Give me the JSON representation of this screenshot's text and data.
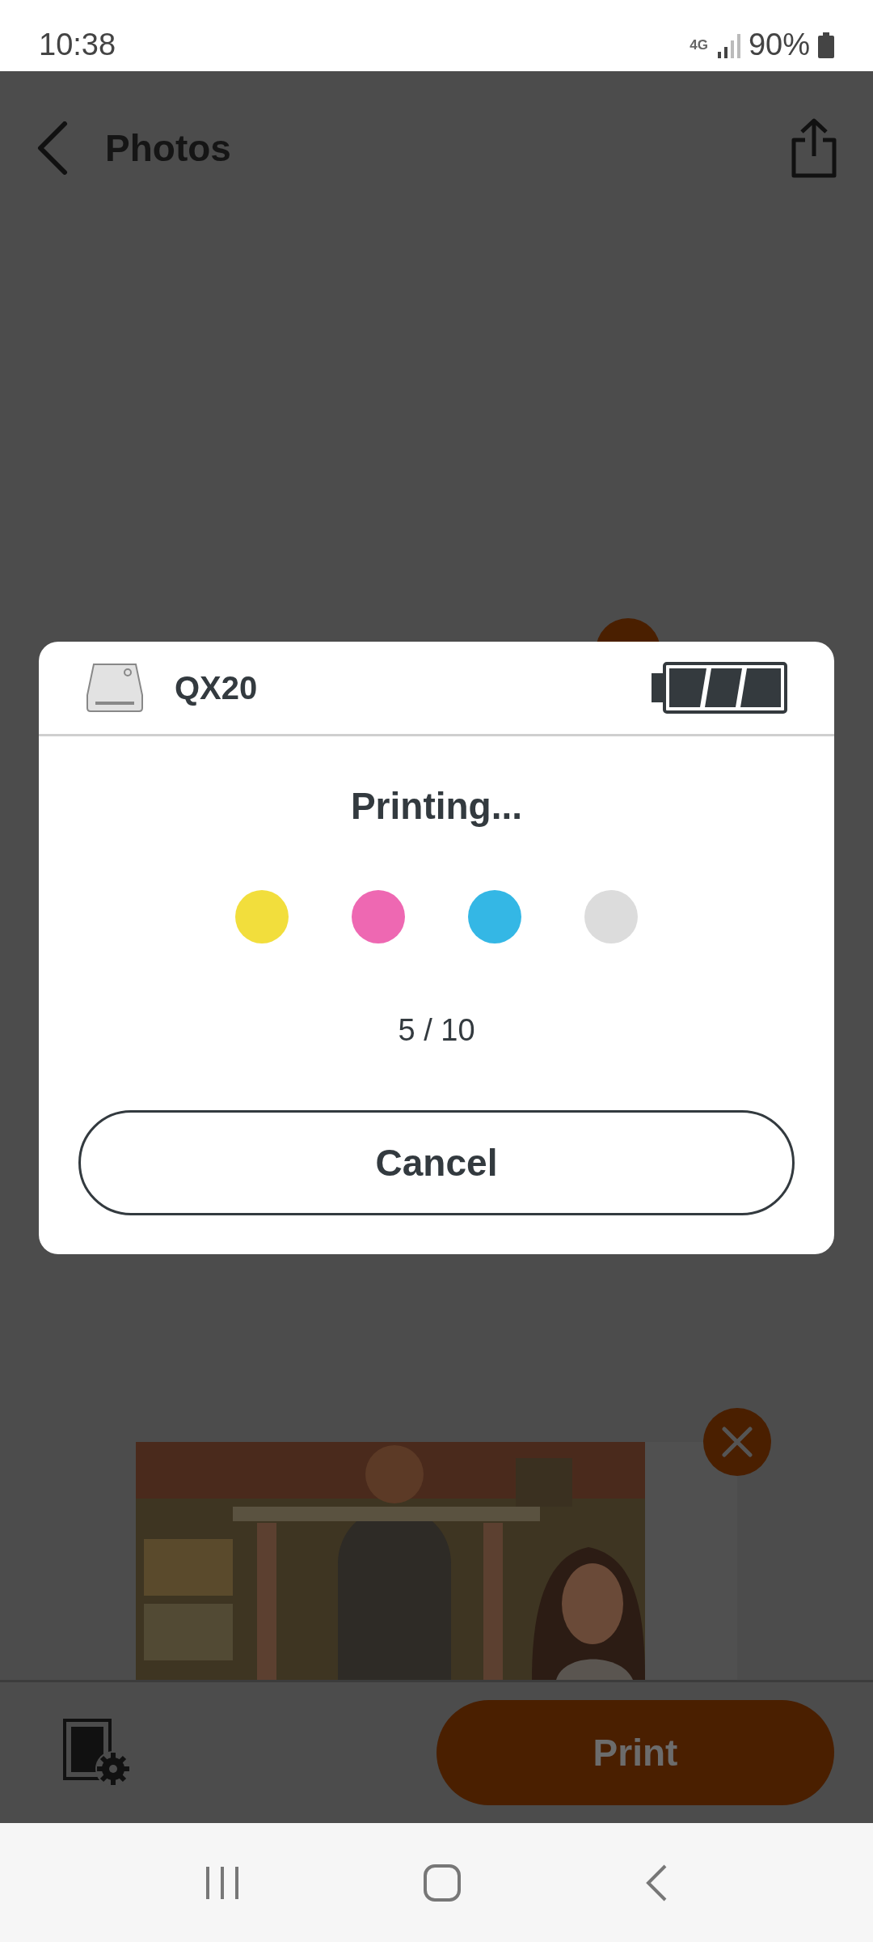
{
  "status_bar": {
    "time": "10:38",
    "network": "4G",
    "battery": "90%"
  },
  "header": {
    "title": "Photos"
  },
  "dialog": {
    "printer_name": "QX20",
    "status": "Printing...",
    "ink_dots": [
      {
        "color": "#f2de3c"
      },
      {
        "color": "#ee68b2"
      },
      {
        "color": "#34b7e5"
      },
      {
        "color": "#dcdcdc"
      }
    ],
    "progress": "5 / 10",
    "cancel_button": "Cancel"
  },
  "bottom_bar": {
    "print_button": "Print"
  }
}
